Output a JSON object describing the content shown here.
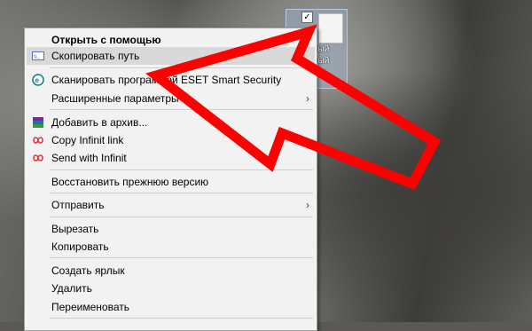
{
  "desktop_icon": {
    "label": "ный\nный\nлок"
  },
  "menu": {
    "open_with": "Открыть с помощью",
    "copy_path": "Скопировать путь",
    "scan": "Сканировать программой ESET Smart Security",
    "advanced": "Расширенные параметры",
    "add_archive": "Добавить в архив...",
    "copy_infinit": "Copy Infinit link",
    "send_infinit": "Send with Infinit",
    "restore": "Восстановить прежнюю версию",
    "send_to": "Отправить",
    "cut": "Вырезать",
    "copy": "Копировать",
    "shortcut": "Создать ярлык",
    "delete": "Удалить",
    "rename": "Переименовать"
  },
  "icons": {
    "copy_path": "path-icon",
    "scan": "eset-icon",
    "archive": "winrar-icon",
    "infinit": "infinit-icon"
  },
  "colors": {
    "arrow": "#ff0000",
    "eset": "#1a7a7a"
  }
}
